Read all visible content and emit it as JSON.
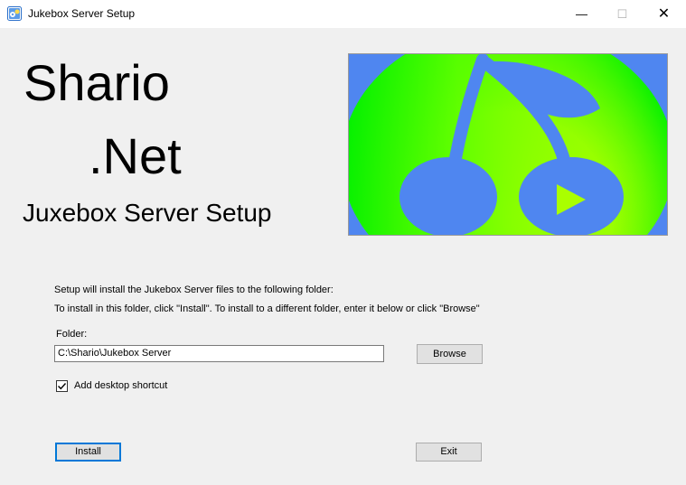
{
  "window": {
    "title": "Jukebox Server Setup",
    "minimize_glyph": "—",
    "maximize_glyph": "☐",
    "close_glyph": "✕"
  },
  "branding": {
    "line1": "Shario",
    "line2": ".Net",
    "line3": "Juxebox Server Setup"
  },
  "banner": {
    "icon": "cherry-play-icon",
    "colors": {
      "bright_green": "#00ff00",
      "lime": "#aaff00",
      "blue": "#4f86f0",
      "play_triangle": "#aaff00"
    }
  },
  "instructions": {
    "line1": "Setup will install the Jukebox Server files to the following folder:",
    "line2": "To install in this folder, click \"Install\". To install to a different folder, enter it below or click \"Browse\""
  },
  "folder": {
    "label": "Folder:",
    "value": "C:\\Shario\\Jukebox Server",
    "browse_label": "Browse"
  },
  "shortcut": {
    "label": "Add desktop shortcut",
    "checked": true
  },
  "actions": {
    "install_label": "Install",
    "exit_label": "Exit"
  },
  "colors": {
    "window_bg": "#f0f0f0",
    "accent": "#0078d7"
  }
}
